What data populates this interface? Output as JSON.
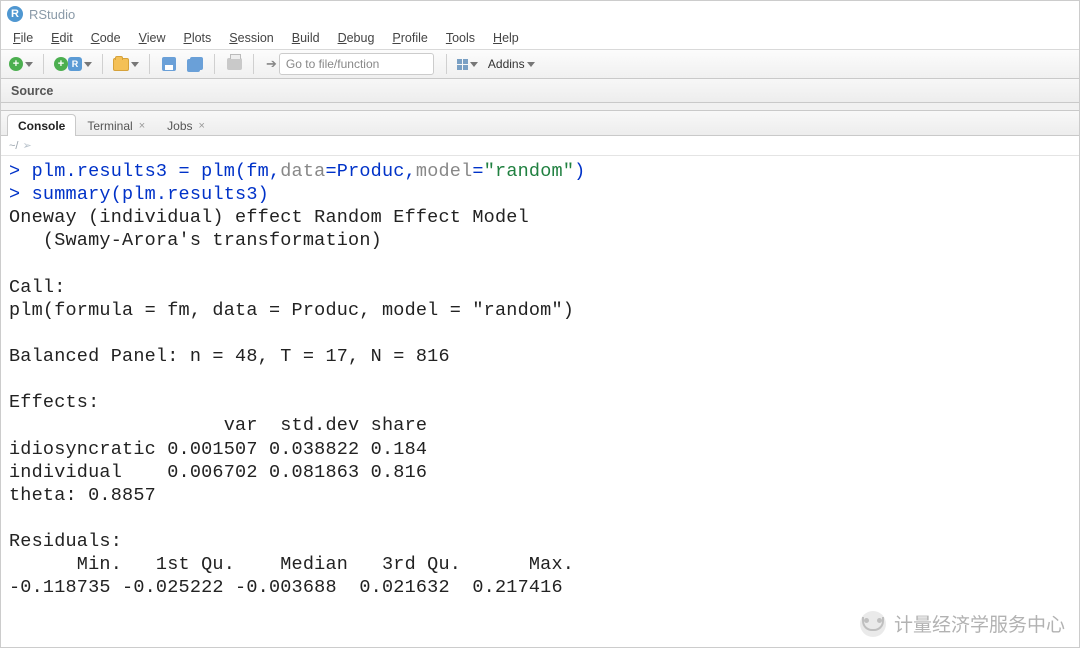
{
  "title": "RStudio",
  "menu": [
    "File",
    "Edit",
    "Code",
    "View",
    "Plots",
    "Session",
    "Build",
    "Debug",
    "Profile",
    "Tools",
    "Help"
  ],
  "toolbar": {
    "goto_placeholder": "Go to file/function",
    "addins_label": "Addins"
  },
  "source_pane_label": "Source",
  "tabs": {
    "console": "Console",
    "terminal": "Terminal",
    "jobs": "Jobs"
  },
  "subbar_path": "~/",
  "console": {
    "cmd1_prefix": "> ",
    "cmd1_a": "plm.results3 = plm(fm,",
    "cmd1_b": "data",
    "cmd1_c": "=Produc,",
    "cmd1_d": "model",
    "cmd1_e": "=",
    "cmd1_f": "\"random\"",
    "cmd1_g": ")",
    "cmd2_prefix": "> ",
    "cmd2": "summary(plm.results3)",
    "out": "Oneway (individual) effect Random Effect Model \n   (Swamy-Arora's transformation)\n\nCall:\nplm(formula = fm, data = Produc, model = \"random\")\n\nBalanced Panel: n = 48, T = 17, N = 816\n\nEffects:\n                   var  std.dev share\nidiosyncratic 0.001507 0.038822 0.184\nindividual    0.006702 0.081863 0.816\ntheta: 0.8857\n\nResiduals:\n      Min.   1st Qu.    Median   3rd Qu.      Max. \n-0.118735 -0.025222 -0.003688  0.021632  0.217416 "
  },
  "watermark": "计量经济学服务中心"
}
